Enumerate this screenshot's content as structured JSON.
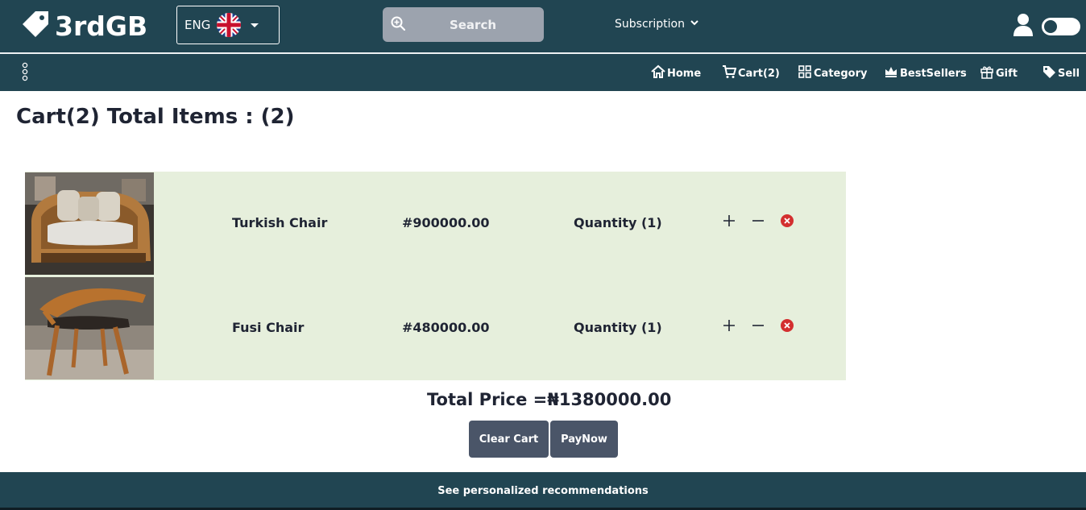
{
  "header": {
    "logo_text": "3rdGB",
    "language": "ENG",
    "search_placeholder": "Search",
    "subscription_label": "Subscription"
  },
  "nav": {
    "items": [
      {
        "label": "Home",
        "icon": "home-icon"
      },
      {
        "label": "Cart(2)",
        "icon": "cart-icon"
      },
      {
        "label": "Category",
        "icon": "grid-icon"
      },
      {
        "label": "BestSellers",
        "icon": "crown-icon"
      },
      {
        "label": "Gift",
        "icon": "gift-icon"
      },
      {
        "label": "Sell",
        "icon": "tag-icon"
      }
    ]
  },
  "main": {
    "title": "Cart(2) Total Items : (2)",
    "cart_items": [
      {
        "name": "Turkish Chair",
        "price": "#900000.00",
        "quantity": "Quantity (1)"
      },
      {
        "name": "Fusi Chair",
        "price": "#480000.00",
        "quantity": "Quantity (1)"
      }
    ],
    "total_price": "Total Price =₦1380000.00",
    "clear_label": "Clear Cart",
    "pay_label": "PayNow"
  },
  "footer": {
    "recommendations": "See personalized recommendations"
  },
  "colors": {
    "header_bg": "#214552",
    "row_bg": "#e6efdc",
    "button_bg": "#4a5568",
    "remove_red": "#d32f2f"
  }
}
